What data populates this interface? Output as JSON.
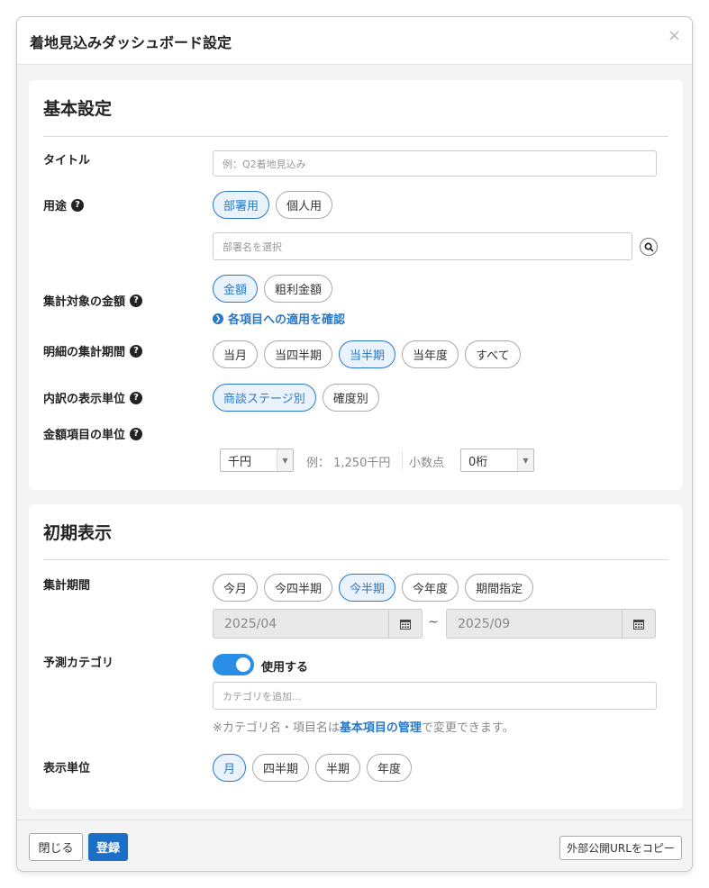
{
  "dialog": {
    "title": "着地見込みダッシュボード設定",
    "close_icon": "×"
  },
  "basic": {
    "heading": "基本設定",
    "title_label": "タイトル",
    "title_placeholder": "例：Q2着地見込み",
    "usage_label": "用途",
    "usage_options": [
      "部署用",
      "個人用"
    ],
    "usage_selected": "部署用",
    "department_placeholder": "部署名を選択",
    "amount_label": "集計対象の金額",
    "amount_options": [
      "金額",
      "粗利金額"
    ],
    "amount_selected": "金額",
    "apply_link": "各項目への適用を確認",
    "period_label": "明細の集計期間",
    "period_options": [
      "当月",
      "当四半期",
      "当半期",
      "当年度",
      "すべて"
    ],
    "period_selected": "当半期",
    "breakdown_label": "内訳の表示単位",
    "breakdown_options": [
      "商談ステージ別",
      "確度別"
    ],
    "breakdown_selected": "商談ステージ別",
    "unit_label": "金額項目の単位",
    "unit_value": "千円",
    "unit_example": "例： 1,250千円",
    "decimal_label": "小数点",
    "decimal_value": "0桁"
  },
  "initial": {
    "heading": "初期表示",
    "period_label": "集計期間",
    "period_options": [
      "今月",
      "今四半期",
      "今半期",
      "今年度",
      "期間指定"
    ],
    "period_selected": "今半期",
    "date_from": "2025/04",
    "date_sep": "~",
    "date_to": "2025/09",
    "category_label": "予測カテゴリ",
    "category_toggle_label": "使用する",
    "category_toggle_on": true,
    "category_placeholder": "カテゴリを追加...",
    "note_prefix": "※カテゴリ名・項目名は",
    "note_link": "基本項目の管理",
    "note_suffix": "で変更できます。",
    "display_unit_label": "表示単位",
    "display_unit_options": [
      "月",
      "四半期",
      "半期",
      "年度"
    ],
    "display_unit_selected": "月"
  },
  "footer": {
    "close_label": "閉じる",
    "submit_label": "登録",
    "copy_url_label": "外部公開URLをコピー"
  },
  "colors": {
    "accent": "#2a78c8",
    "primary_button": "#1b6fc6",
    "toggle_on": "#2a8ee6"
  }
}
